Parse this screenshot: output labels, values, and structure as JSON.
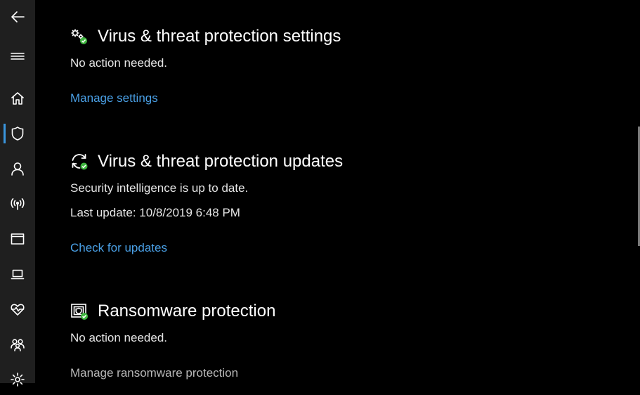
{
  "colors": {
    "sidebar_bg": "#1f1f1f",
    "main_bg": "#000000",
    "link": "#4aa0e6",
    "active_indicator": "#3a96dd",
    "ok_badge": "#3fb63f"
  },
  "nav": {
    "items": [
      {
        "icon": "back-arrow-icon"
      },
      {
        "icon": "hamburger-menu-icon"
      },
      {
        "icon": "home-icon"
      },
      {
        "icon": "shield-icon",
        "active": true
      },
      {
        "icon": "person-icon"
      },
      {
        "icon": "wireless-icon"
      },
      {
        "icon": "browser-window-icon"
      },
      {
        "icon": "laptop-icon"
      },
      {
        "icon": "heart-pulse-icon"
      },
      {
        "icon": "family-icon"
      },
      {
        "icon": "gear-icon"
      }
    ]
  },
  "sections": {
    "settings": {
      "icon": "gears-check-icon",
      "title": "Virus & threat protection settings",
      "status": "No action needed.",
      "link": "Manage settings"
    },
    "updates": {
      "icon": "refresh-check-icon",
      "title": "Virus & threat protection updates",
      "status": "Security intelligence is up to date.",
      "last_update": "Last update: 10/8/2019 6:48 PM",
      "link": "Check for updates"
    },
    "ransomware": {
      "icon": "ransomware-check-icon",
      "title": "Ransomware protection",
      "status": "No action needed.",
      "link": "Manage ransomware protection"
    }
  }
}
